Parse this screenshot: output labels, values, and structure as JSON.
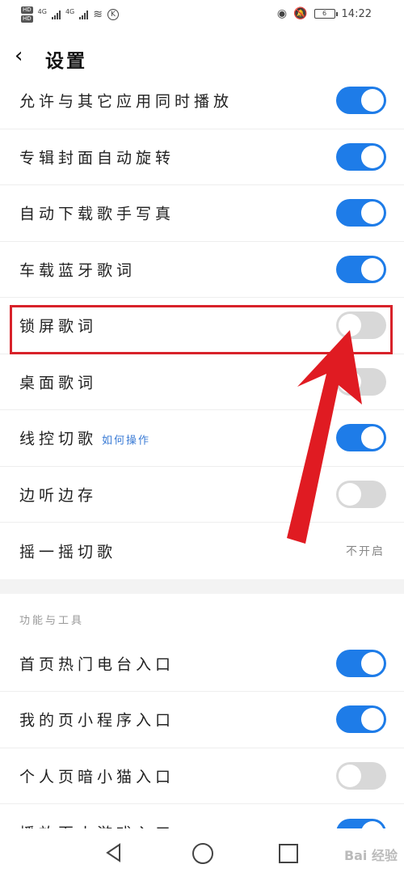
{
  "status_bar": {
    "hd1": "HD",
    "hd2": "HD",
    "net1": "4G",
    "net2": "4G",
    "k_icon": "K",
    "battery": "6",
    "time": "14:22"
  },
  "header": {
    "back_icon": "chevron-left-icon",
    "title": "设置"
  },
  "rows": [
    {
      "label": "允许与其它应用同时播放",
      "toggle": true
    },
    {
      "label": "专辑封面自动旋转",
      "toggle": true
    },
    {
      "label": "自动下载歌手写真",
      "toggle": true
    },
    {
      "label": "车载蓝牙歌词",
      "toggle": true
    },
    {
      "label": "锁屏歌词",
      "toggle": false
    },
    {
      "label": "桌面歌词",
      "toggle": false
    },
    {
      "label": "线控切歌",
      "hint": "如何操作",
      "toggle": true
    },
    {
      "label": "边听边存",
      "toggle": false
    },
    {
      "label": "摇一摇切歌",
      "value": "不开启"
    }
  ],
  "section": {
    "title": "功能与工具"
  },
  "tool_rows": [
    {
      "label": "首页热门电台入口",
      "toggle": true
    },
    {
      "label": "我的页小程序入口",
      "toggle": true
    },
    {
      "label": "个人页暗小猫入口",
      "toggle": false
    },
    {
      "label": "播放页小游戏入口",
      "toggle": true
    }
  ],
  "colors": {
    "toggle_on": "#1e7ce8",
    "toggle_off": "#d8d8d8",
    "highlight": "#d8222a",
    "arrow": "#e01b22"
  },
  "watermark": "Bai 经验"
}
